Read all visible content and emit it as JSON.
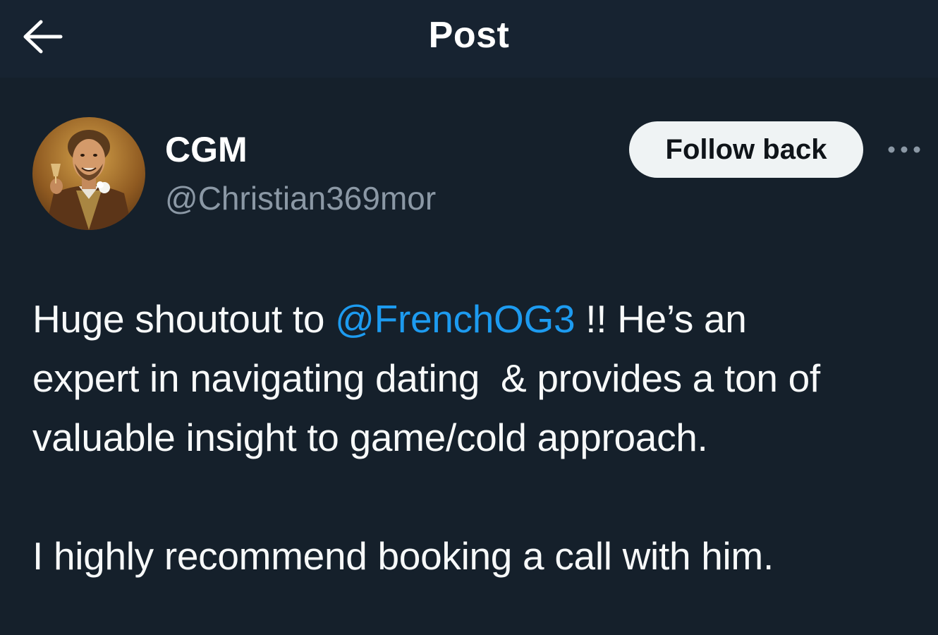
{
  "header": {
    "title": "Post",
    "back_icon": "arrow-left-icon"
  },
  "author": {
    "display_name": "CGM",
    "handle": "@Christian369mor",
    "avatar_icon": "avatar-image"
  },
  "actions": {
    "follow_label": "Follow back",
    "more_icon": "more-horizontal-icon"
  },
  "post": {
    "line1_before": "Huge shoutout to ",
    "mention": "@FrenchOG3",
    "line1_after": " !! He’s an",
    "line2": "expert in navigating dating  & provides a ton of",
    "line3": "valuable insight to game/cold approach.",
    "line4": "I highly recommend booking a call with him."
  },
  "colors": {
    "background": "#15202b",
    "mention": "#1d9bf0",
    "secondary_text": "#8b98a5",
    "button_bg": "#eff3f4"
  }
}
